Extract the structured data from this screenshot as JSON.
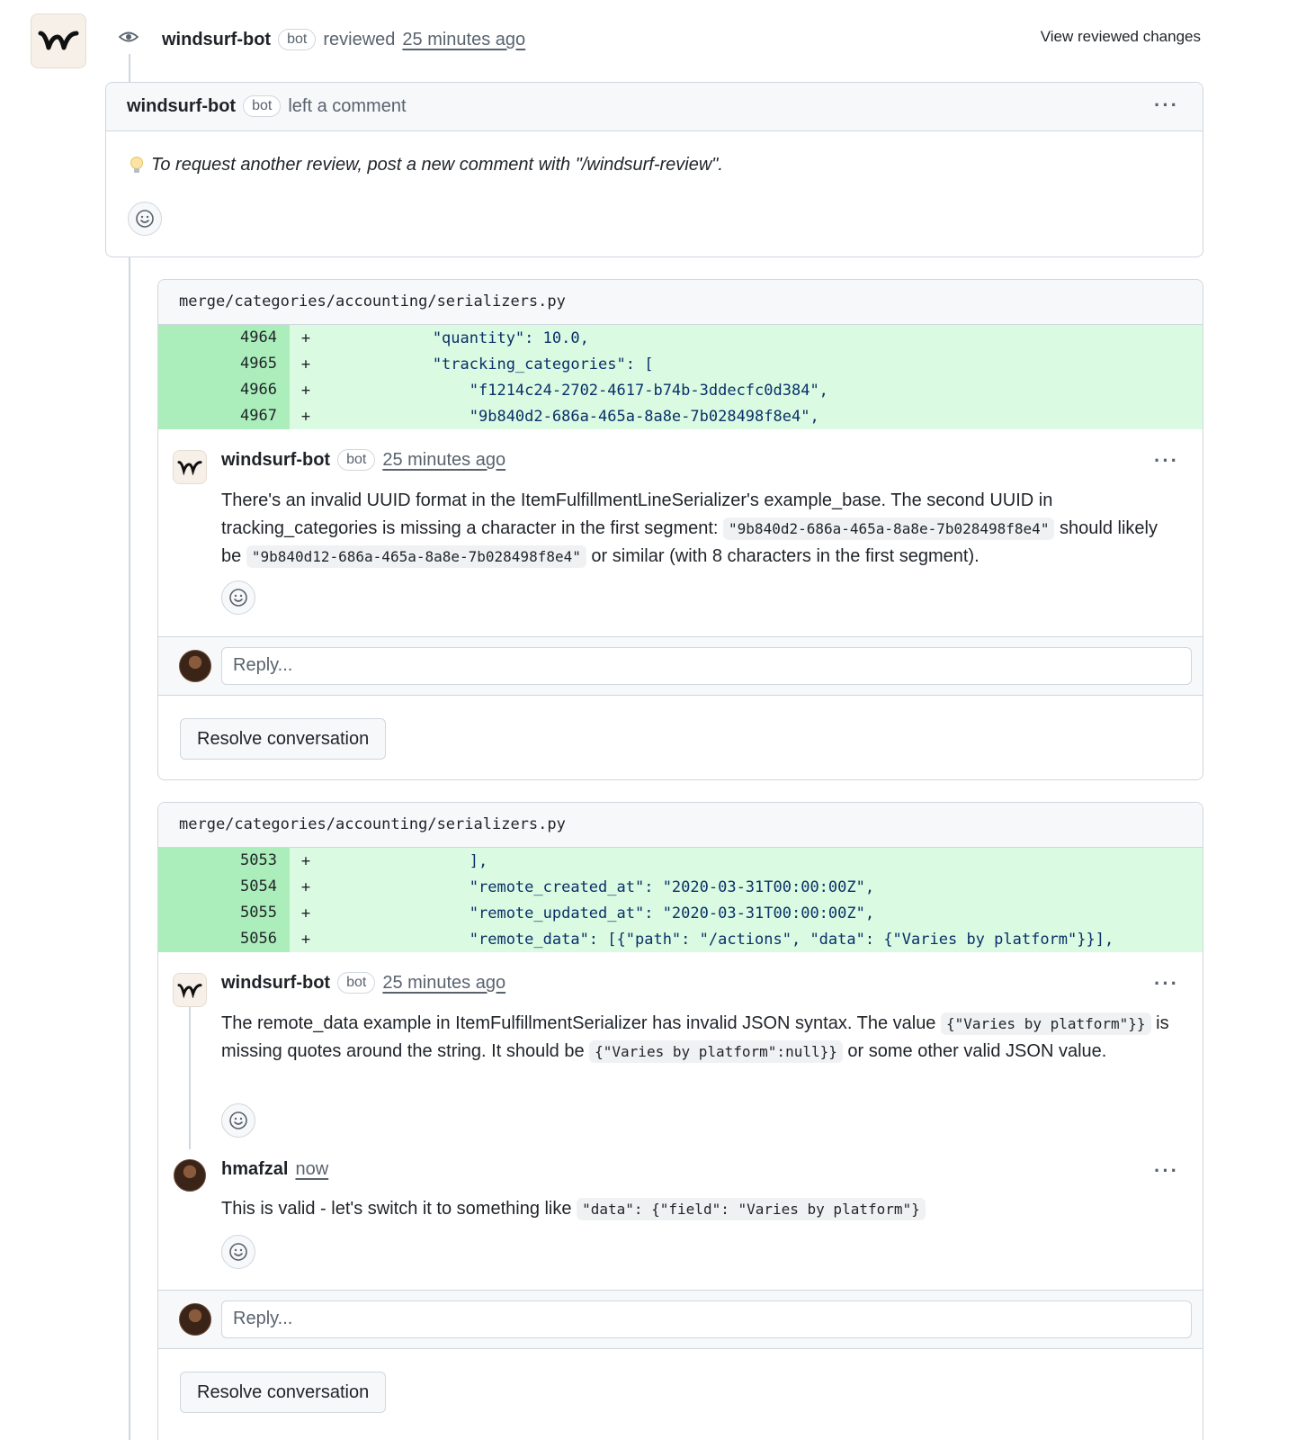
{
  "review": {
    "author": "windsurf-bot",
    "bot_label": "bot",
    "action": "reviewed",
    "time": "25 minutes ago",
    "view_changes": "View reviewed changes"
  },
  "summary_comment": {
    "author": "windsurf-bot",
    "bot_label": "bot",
    "action": "left a comment",
    "tip": "To request another review, post a new comment with \"/windsurf-review\"."
  },
  "threads": [
    {
      "file": "merge/categories/accounting/serializers.py",
      "lines": [
        {
          "num": "4964",
          "sign": "+",
          "code": "            \"quantity\": 10.0,"
        },
        {
          "num": "4965",
          "sign": "+",
          "code": "            \"tracking_categories\": ["
        },
        {
          "num": "4966",
          "sign": "+",
          "code": "                \"f1214c24-2702-4617-b74b-3ddecfc0d384\","
        },
        {
          "num": "4967",
          "sign": "+",
          "code": "                \"9b840d2-686a-465a-8a8e-7b028498f8e4\","
        }
      ],
      "comment": {
        "author": "windsurf-bot",
        "bot_label": "bot",
        "time": "25 minutes ago",
        "text_1": "There's an invalid UUID format in the ItemFulfillmentLineSerializer's example_base. The second UUID in tracking_categories is missing a character in the first segment:",
        "code_1": "\"9b840d2-686a-465a-8a8e-7b028498f8e4\"",
        "text_2": "should likely be",
        "code_2": "\"9b840d12-686a-465a-8a8e-7b028498f8e4\"",
        "text_3": "or similar (with 8 characters in the first segment)."
      },
      "reply_placeholder": "Reply...",
      "resolve_label": "Resolve conversation"
    },
    {
      "file": "merge/categories/accounting/serializers.py",
      "lines": [
        {
          "num": "5053",
          "sign": "+",
          "code": "                ],"
        },
        {
          "num": "5054",
          "sign": "+",
          "code": "                \"remote_created_at\": \"2020-03-31T00:00:00Z\","
        },
        {
          "num": "5055",
          "sign": "+",
          "code": "                \"remote_updated_at\": \"2020-03-31T00:00:00Z\","
        },
        {
          "num": "5056",
          "sign": "+",
          "code": "                \"remote_data\": [{\"path\": \"/actions\", \"data\": {\"Varies by platform\"}}],"
        }
      ],
      "comment": {
        "author": "windsurf-bot",
        "bot_label": "bot",
        "time": "25 minutes ago",
        "text_1": "The remote_data example in ItemFulfillmentSerializer has invalid JSON syntax. The value",
        "code_1": "{\"Varies by platform\"}}",
        "text_2": "is missing quotes around the string. It should be",
        "code_2": "{\"Varies by platform\":null}}",
        "text_3": "or some other valid JSON value."
      },
      "reply": {
        "author": "hmafzal",
        "time": "now",
        "text_1": "This is valid - let's switch it to something like",
        "code_1": "\"data\": {\"field\": \"Varies by platform\"}"
      },
      "reply_placeholder": "Reply...",
      "resolve_label": "Resolve conversation"
    }
  ],
  "icons": {
    "eye": "eye-icon",
    "smiley": "smiley-icon",
    "bulb": "lightbulb-icon",
    "kebab": "kebab-horizontal-icon"
  },
  "colors": {
    "diff_added_bg": "#dafbe1",
    "diff_added_num_bg": "#aceebb",
    "border": "#d0d7de",
    "muted_text": "#59636e"
  }
}
